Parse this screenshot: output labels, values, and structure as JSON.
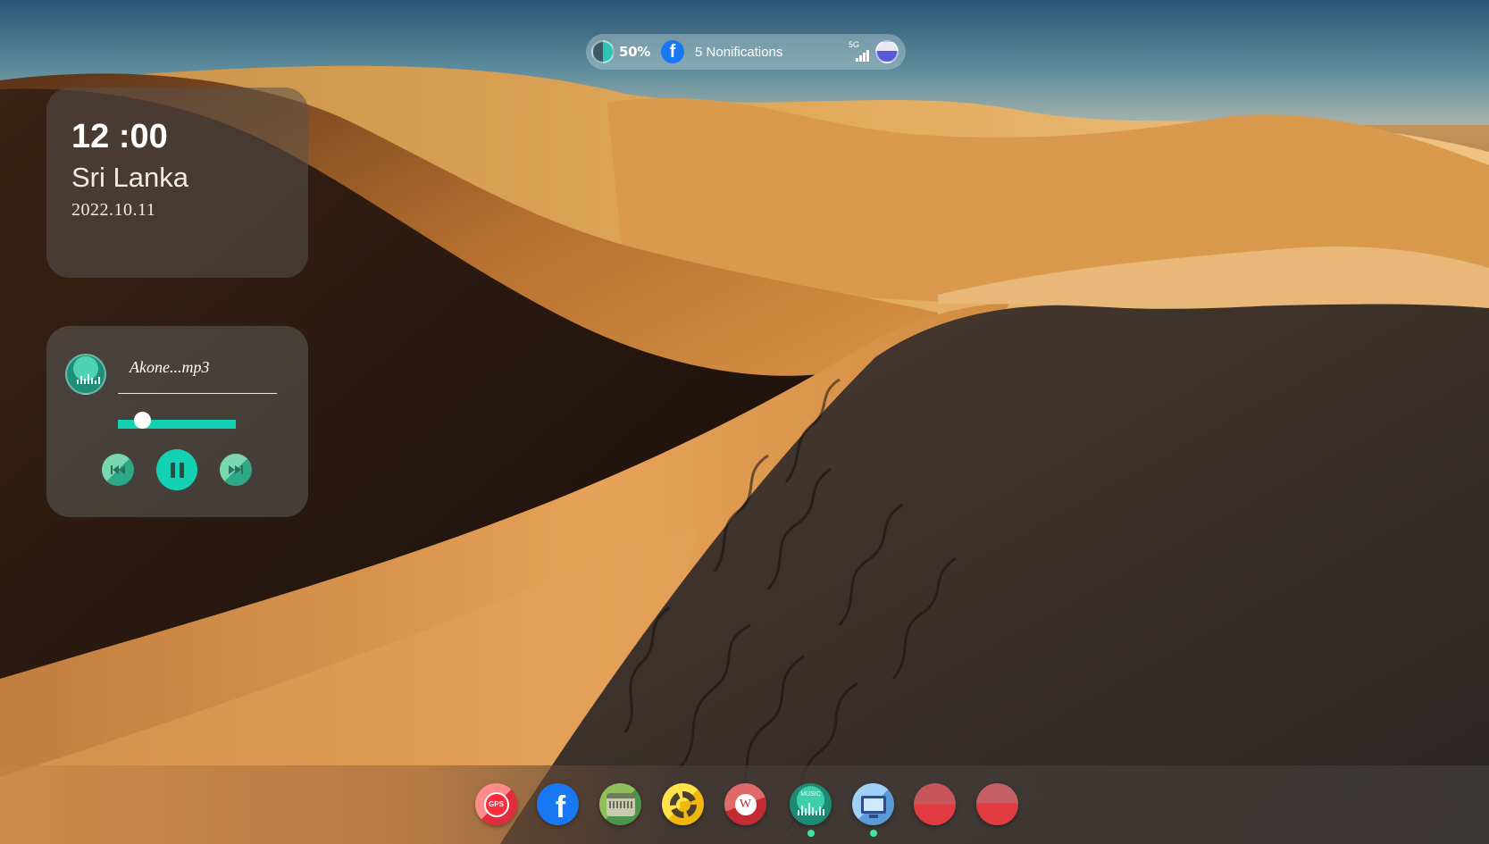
{
  "status_bar": {
    "battery_percent": "50%",
    "battery_level": 0.5,
    "notification_app_icon": "facebook-icon",
    "notifications_text": "5 Nonifications",
    "signal_label": "5G",
    "profile_icon": "profile-avatar-icon"
  },
  "clock_widget": {
    "time": "12 :00",
    "location": "Sri Lanka",
    "date": "2022.10.11"
  },
  "music_widget": {
    "track_name": "Akone...mp3",
    "progress": 0.15,
    "album_icon": "music-album-icon",
    "controls": {
      "previous_icon": "skip-previous-icon",
      "pause_icon": "pause-icon",
      "next_icon": "skip-next-icon"
    }
  },
  "dock": {
    "apps": [
      {
        "name": "gps",
        "icon": "gps-pin-icon",
        "label": "GPS",
        "running": false
      },
      {
        "name": "facebook",
        "icon": "facebook-icon",
        "label": "f",
        "running": false
      },
      {
        "name": "calendar",
        "icon": "calendar-icon",
        "label": "",
        "running": false
      },
      {
        "name": "settings",
        "icon": "gear-icon",
        "label": "",
        "running": false
      },
      {
        "name": "word",
        "icon": "word-icon",
        "label": "W",
        "running": false
      },
      {
        "name": "music",
        "icon": "music-icon",
        "label": "MUSIC",
        "running": true
      },
      {
        "name": "computer",
        "icon": "computer-icon",
        "label": "",
        "running": true
      },
      {
        "name": "app-8",
        "icon": "app-icon",
        "label": "",
        "running": false
      },
      {
        "name": "app-9",
        "icon": "app-icon",
        "label": "",
        "running": false
      }
    ]
  },
  "colors": {
    "accent": "#14d1b4",
    "running_dot": "#3ee6a0",
    "facebook_blue": "#1877f2"
  }
}
